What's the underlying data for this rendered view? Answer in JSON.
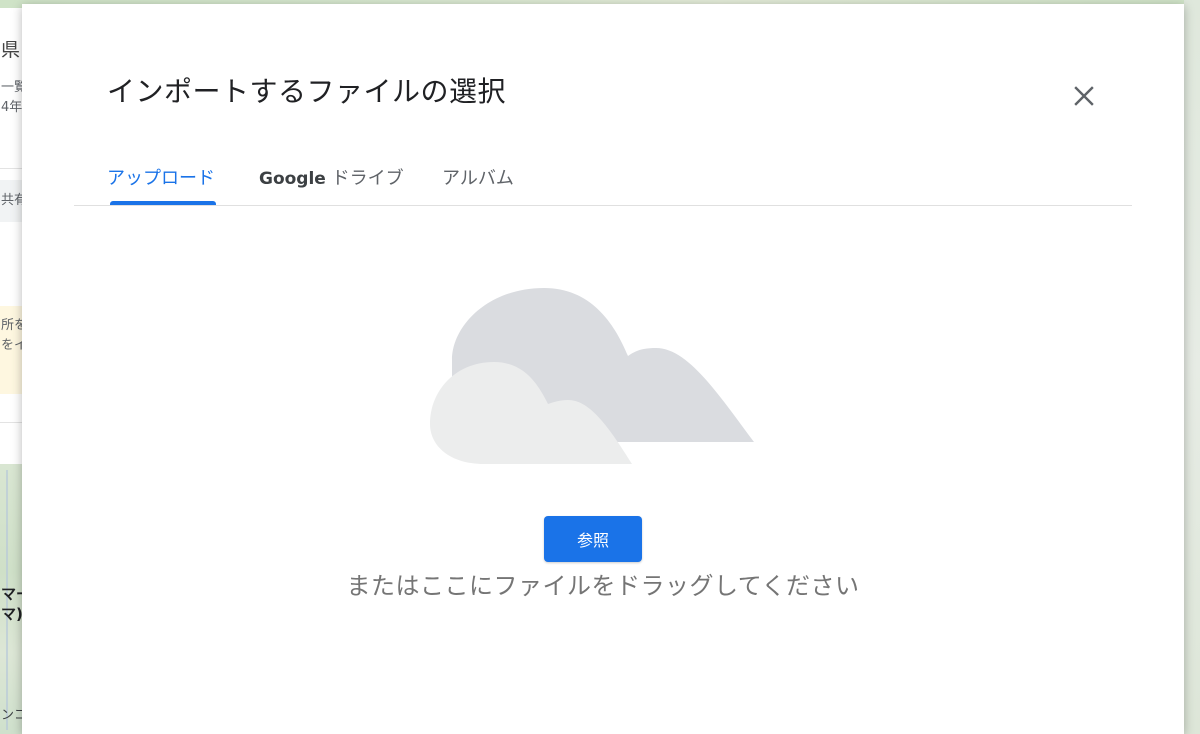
{
  "background": {
    "fragments": [
      "県",
      "一覧",
      "4年",
      "共有",
      "所を",
      "をイ",
      "マー",
      "マ)",
      "ンコ"
    ]
  },
  "dialog": {
    "title": "インポートするファイルの選択",
    "close_icon": "close-icon",
    "tabs": [
      {
        "label": "アップロード",
        "active": true
      },
      {
        "label_brand": "Google",
        "label_rest": " ドライブ",
        "active": false
      },
      {
        "label": "アルバム",
        "active": false
      }
    ],
    "upload": {
      "illustration_icon": "cloud-icon",
      "browse_label": "参照",
      "drag_hint": "またはここにファイルをドラッグしてください"
    }
  },
  "colors": {
    "accent": "#1a73e8",
    "title_text": "#202124",
    "secondary_text": "#757575",
    "cloud_back": "#dadce0",
    "cloud_front": "#eceded"
  }
}
